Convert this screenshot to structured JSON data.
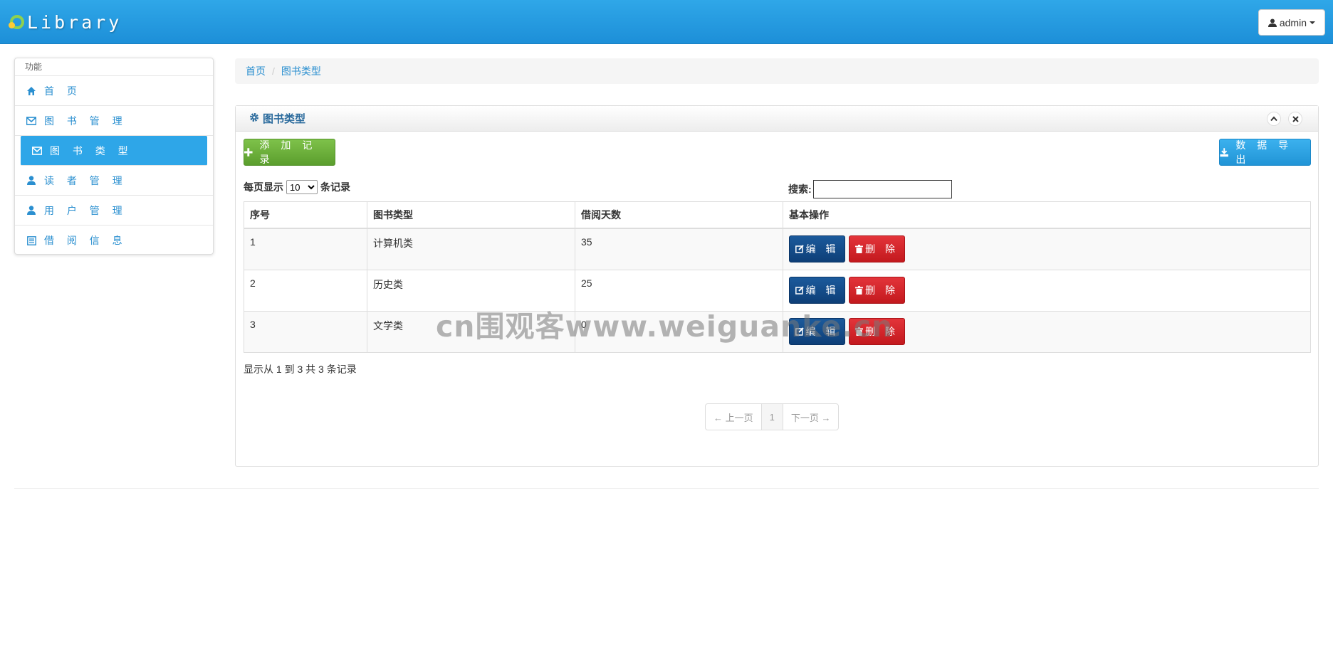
{
  "app": {
    "brand": "Library",
    "user": "admin"
  },
  "sidebar": {
    "header": "功能",
    "items": [
      {
        "label": "首 页",
        "icon": "home-icon"
      },
      {
        "label": "图 书 管 理",
        "icon": "envelope-icon"
      },
      {
        "label": "图 书 类 型",
        "icon": "envelope-icon"
      },
      {
        "label": "读 者 管 理",
        "icon": "user-icon"
      },
      {
        "label": "用 户 管 理",
        "icon": "user-icon"
      },
      {
        "label": "借 阅 信 息",
        "icon": "list-icon"
      }
    ],
    "active_index": 2
  },
  "breadcrumb": {
    "home": "首页",
    "current": "图书类型"
  },
  "panel": {
    "title": "图书类型",
    "icon": "gear-icon",
    "tools": [
      "chevron-up-icon",
      "close-icon"
    ]
  },
  "toolbar": {
    "add_label": "添 加 记 录",
    "export_label": "数 据 导 出"
  },
  "length": {
    "prefix": "每页显示",
    "value": "10",
    "suffix": "条记录"
  },
  "search": {
    "label": "搜索:",
    "value": ""
  },
  "table": {
    "headers": [
      "序号",
      "图书类型",
      "借阅天数",
      "基本操作"
    ],
    "rows": [
      {
        "id": "1",
        "type": "计算机类",
        "days": "35"
      },
      {
        "id": "2",
        "type": "历史类",
        "days": "25"
      },
      {
        "id": "3",
        "type": "文学类",
        "days": "0"
      }
    ],
    "edit_label": "编 辑",
    "delete_label": "删 除"
  },
  "info": "显示从 1 到 3 共 3 条记录",
  "pager": {
    "prev": "← 上一页",
    "current": "1",
    "next": "下一页 →"
  },
  "watermark": "cn围观客www.weiguanke.cn",
  "colors": {
    "navbar": "#2fa7e8",
    "active": "#2ea6e8",
    "add": "#5b9e2d",
    "edit": "#0e3f78",
    "delete": "#c3191e"
  }
}
